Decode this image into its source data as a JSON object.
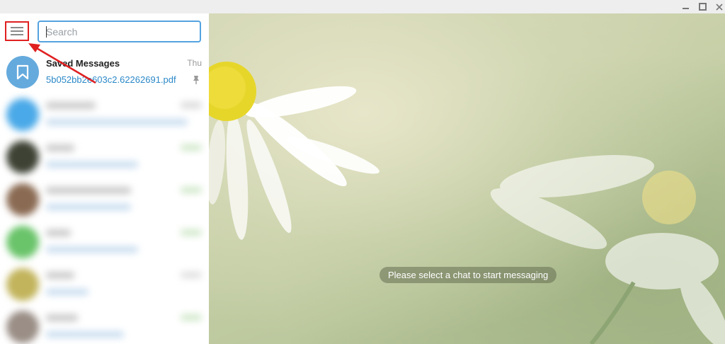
{
  "window": {
    "controls": [
      "minimize",
      "maximize",
      "close"
    ]
  },
  "sidebar": {
    "search": {
      "placeholder": "Search",
      "value": ""
    },
    "chats": [
      {
        "name": "Saved Messages",
        "time": "Thu",
        "preview": "5b052bb2e603c2.62262691.pdf",
        "pinned": true,
        "icon": "bookmark-icon"
      }
    ]
  },
  "main": {
    "empty_message": "Please select a chat to start messaging"
  },
  "annotation": {
    "highlight_color": "#e02020"
  },
  "colors": {
    "accent": "#54a3e0",
    "saved_avatar": "#65aadd",
    "link": "#2a88c8"
  }
}
